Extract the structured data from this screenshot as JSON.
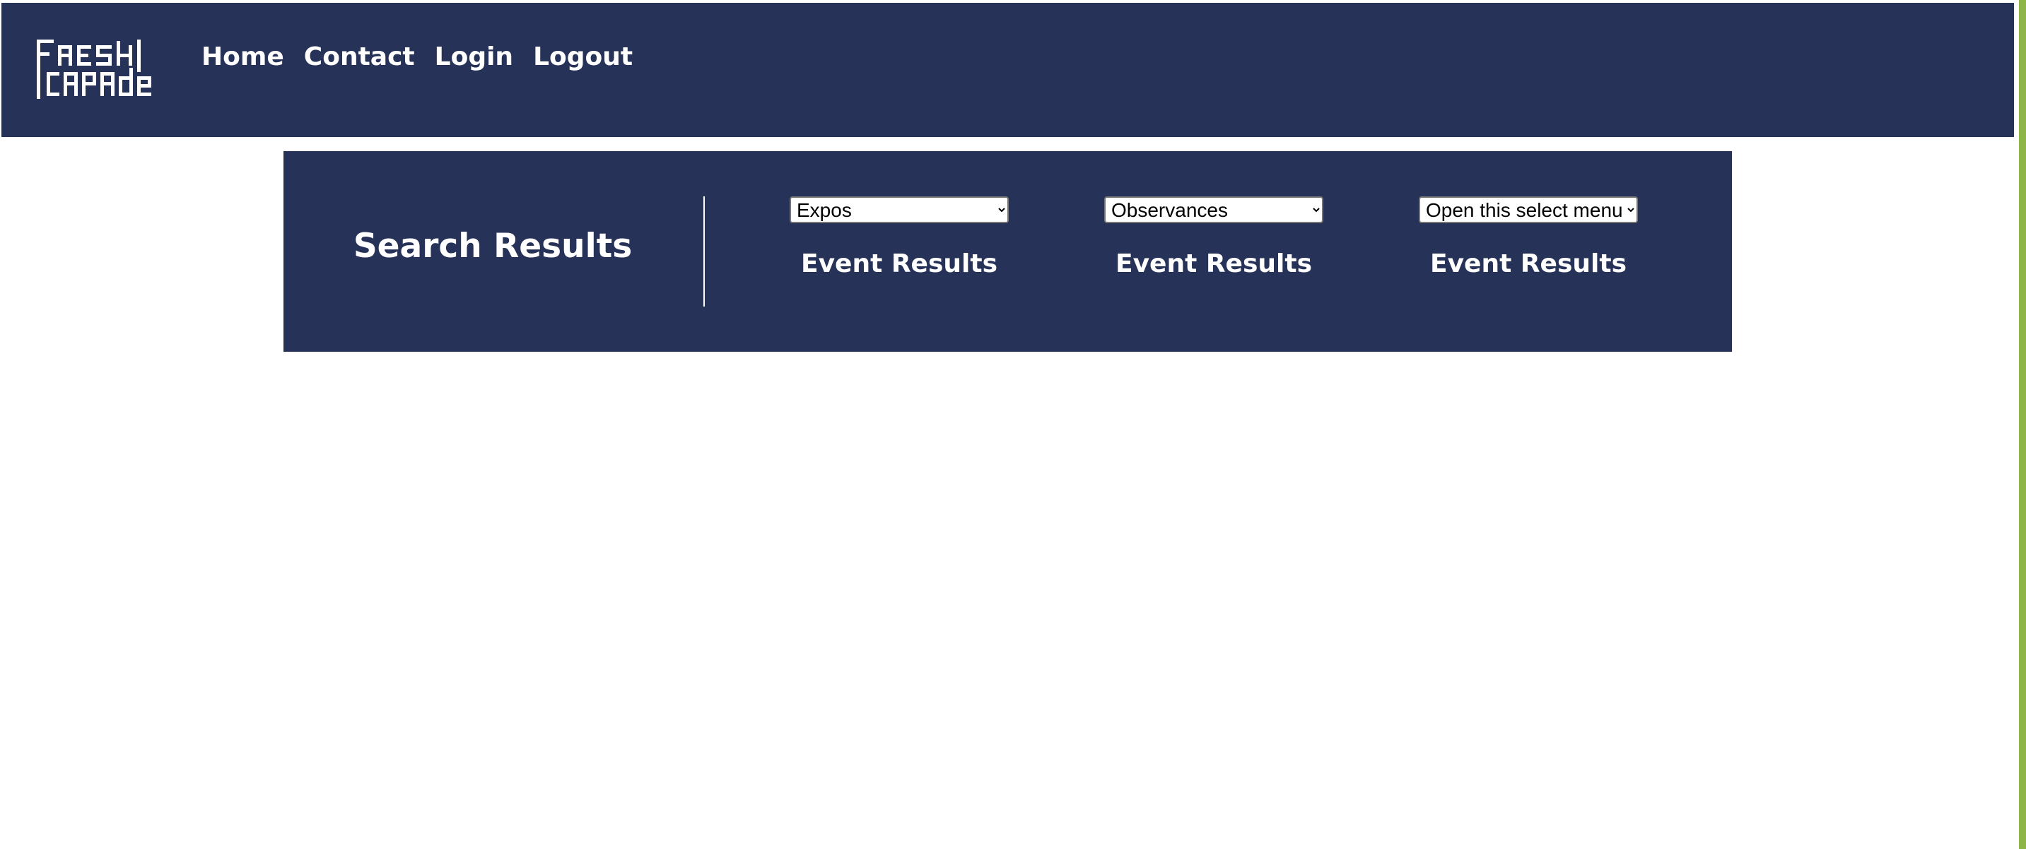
{
  "brand": {
    "logo_alt": "Fresh Capade",
    "logo_line1": "FRESH",
    "logo_line2": "CAPADE"
  },
  "nav": {
    "links": [
      {
        "label": "Home"
      },
      {
        "label": "Contact"
      },
      {
        "label": "Login"
      },
      {
        "label": "Logout"
      }
    ]
  },
  "results": {
    "title": "Search Results",
    "filters": [
      {
        "selected": "Expos",
        "result_label": "Event Results"
      },
      {
        "selected": "Observances",
        "result_label": "Event Results"
      },
      {
        "selected": "Open this select menu",
        "result_label": "Event Results"
      }
    ]
  },
  "colors": {
    "navy": "#263257",
    "accent_green": "#8db548",
    "text": "#ffffff"
  }
}
